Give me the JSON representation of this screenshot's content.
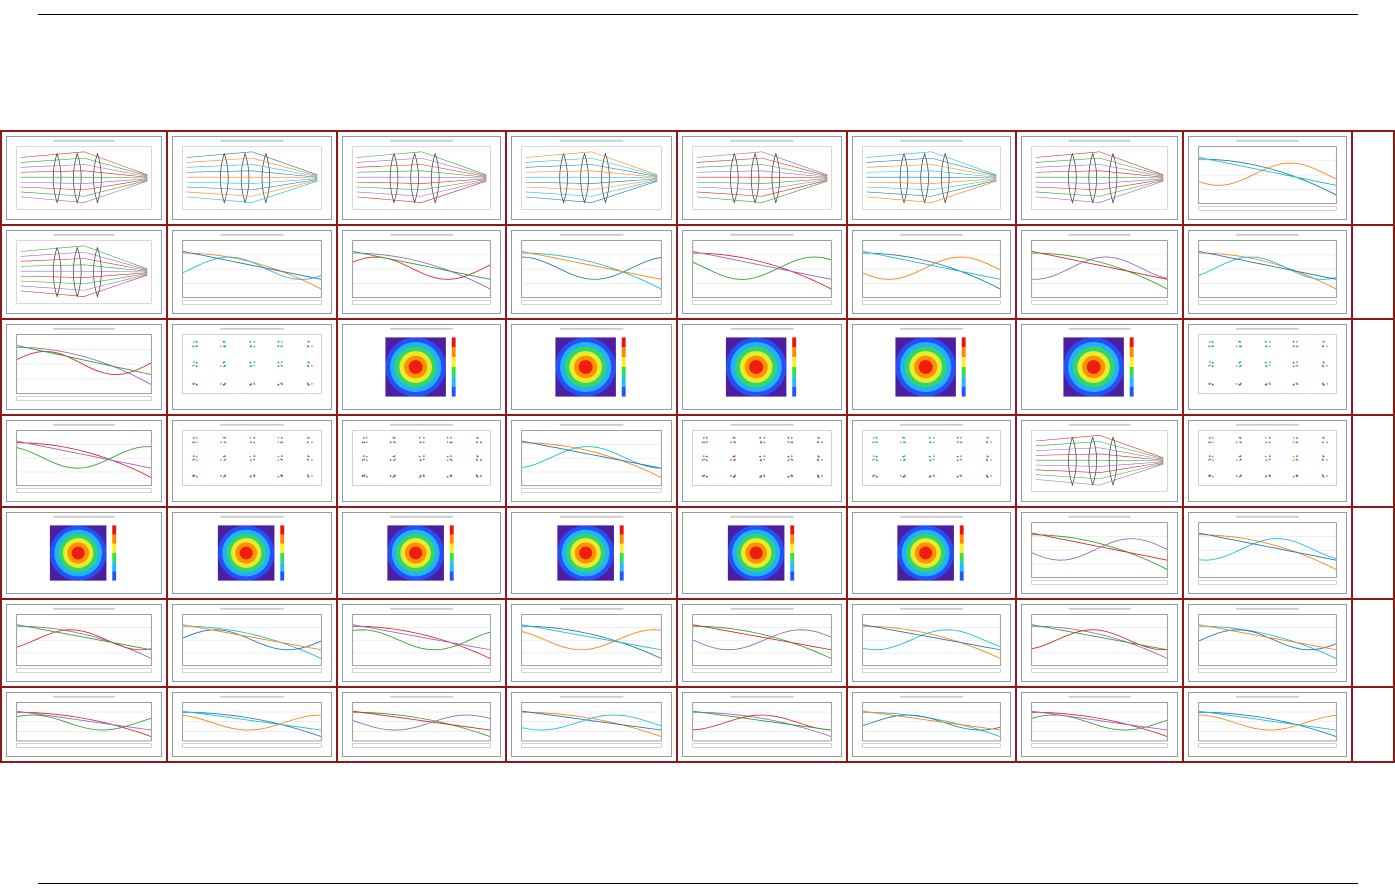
{
  "page": {
    "accent_color": "#8b1a1a"
  },
  "gallery": {
    "rows": 7,
    "cols": 8,
    "tiles": [
      [
        "optical-layout",
        "fisheye-layout",
        "fisheye-shaded",
        "shaded-model",
        "wireframe-3d",
        "slider-layout",
        "slider-layout-2",
        "ray-fan-layout"
      ],
      [
        "lens-drawing",
        "ray-fan-grid",
        "ray-aberration",
        "ray-fan-sketch",
        "ray-fan-grid-2",
        "ray-aberration-2",
        "ray-fan-sketch-2",
        "chromatic-focal-shift"
      ],
      [
        "lateral-color",
        "grid-distortion",
        "wavefront-maps",
        "wavefront-pyramid",
        "wavefront-map",
        "wavefront-3d",
        "interferogram",
        "spot-matrix"
      ],
      [
        "spot-diagram-fields",
        "spot-diagram",
        "spot-diagram-2",
        "rms-vs-field",
        "pupil-grid",
        "footprint",
        "lens-layout-rays",
        "footprint-circles"
      ],
      [
        "psf-panels",
        "psf-pyramid",
        "fft-psf-3d",
        "fft-psf-map",
        "huygens-psf-3d",
        "huygens-psf-map",
        "line-spread",
        "mtf-multi"
      ],
      [
        "through-focus-mtf",
        "mtf-single",
        "mtf-vs-field",
        "mtf-vs-field-2",
        "mtf-curve",
        "mtf-slider",
        "through-focus-multi",
        "mtf-vs-field-3"
      ],
      [
        "multi-curves",
        "encircled-energy",
        "ensquared-energy",
        "line-spread-2",
        "encircled-energy-2",
        "ensquared-energy-2",
        "edge-spread",
        "tolerance-spreadsheet"
      ]
    ],
    "thumb_colors": [
      "#d62728",
      "#1f77b4",
      "#2ca02c",
      "#ff7f0e",
      "#9467bd",
      "#17becf"
    ]
  }
}
